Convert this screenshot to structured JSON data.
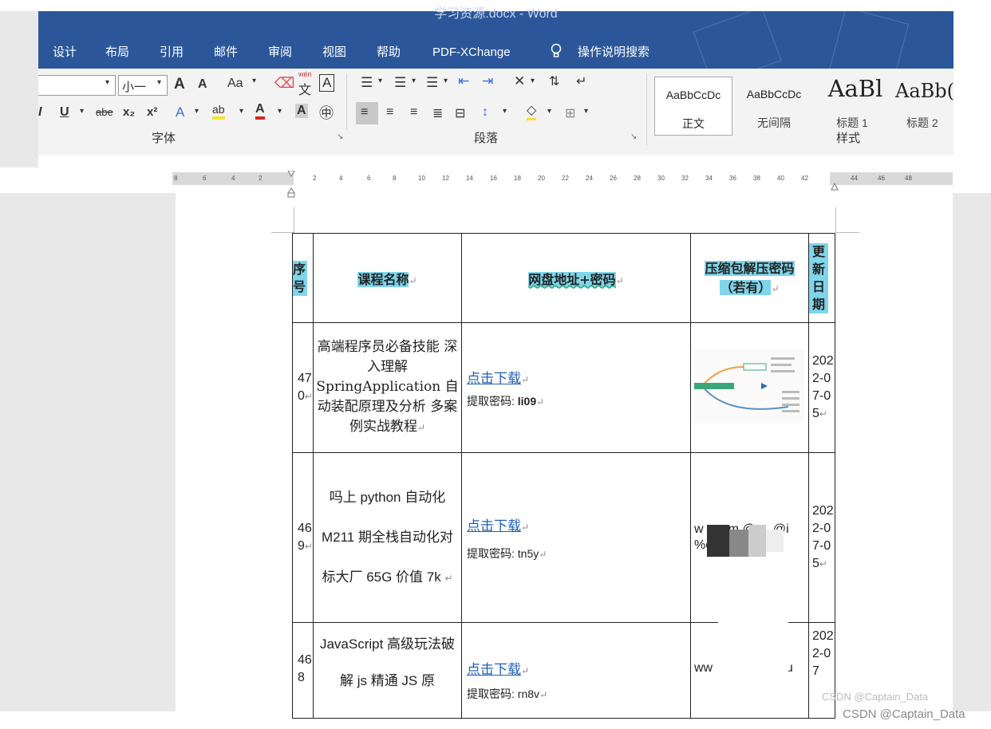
{
  "window": {
    "title": "学习资源.docx  -  Word"
  },
  "menu": [
    "设计",
    "布局",
    "引用",
    "邮件",
    "审阅",
    "视图",
    "帮助",
    "PDF-XChange"
  ],
  "search": {
    "label": "操作说明搜索"
  },
  "font": {
    "size": "小一",
    "grow": "A",
    "shrink": "A",
    "case": "Aa",
    "phonetic_top": "wén",
    "phonetic_char": "文",
    "border_char": "A",
    "italic": "I",
    "underline": "U",
    "strike": "abe",
    "sub": "x₂",
    "sup": "x²",
    "effects": "A",
    "highlight": "ab",
    "color": "A",
    "shade": "A",
    "encircle": "㊥",
    "group_label": "字体"
  },
  "paragraph": {
    "group_label": "段落"
  },
  "styles": {
    "items": [
      {
        "preview": "AaBbCcDc",
        "name": "正文"
      },
      {
        "preview": "AaBbCcDc",
        "name": "无间隔"
      },
      {
        "preview": "AaBl",
        "name": "标题 1"
      },
      {
        "preview": "AaBb(",
        "name": "标题 2"
      }
    ],
    "group_label": "样式"
  },
  "ruler": {
    "left_ticks": [
      "8",
      "6",
      "4",
      "2"
    ],
    "right_ticks": [
      "2",
      "4",
      "6",
      "8",
      "10",
      "12",
      "14",
      "16",
      "18",
      "20",
      "22",
      "24",
      "26",
      "28",
      "30",
      "32",
      "34",
      "36",
      "38",
      "40",
      "42",
      "44",
      "46",
      "48"
    ]
  },
  "table": {
    "headers": [
      "序号",
      "课程名称",
      "网盘地址+密码",
      "压缩包解压密码（若有）",
      "更新日期"
    ],
    "rows": [
      {
        "index": "470",
        "name": "高端程序员必备技能 深入理解 SpringApplication 自动装配原理及分析 多案例实战教程",
        "link": "点击下载",
        "password_label": "提取密码: ",
        "password": "li09",
        "unzip": "",
        "date": "2022-07-05"
      },
      {
        "index": "469",
        "name": "吗上 python 自动化 M211 期全栈自动化对标大厂 65G 价值 7k",
        "link": "点击下载",
        "password_label": "提取密码: ",
        "password": "tn5y",
        "unzip": "w     om @     @i %c",
        "date": "2022-07-05"
      },
      {
        "index": "468",
        "name": "JavaScript 高级玩法破解 js 精通 JS 原",
        "link": "点击下载",
        "password_label": "提取密码: ",
        "password": "rn8v",
        "unzip": "ww    n @)    2 Ju",
        "date": "2022-07"
      }
    ]
  },
  "watermark": {
    "text": "CSDN @Captain_Data"
  }
}
